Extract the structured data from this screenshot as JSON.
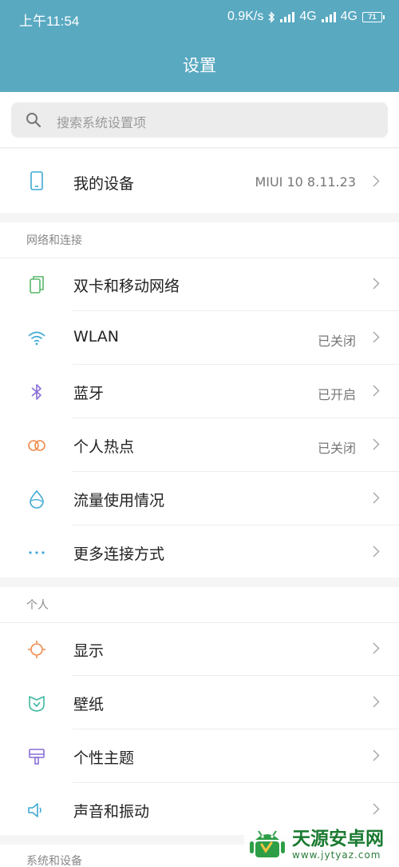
{
  "status_bar": {
    "time": "上午11:54",
    "net_speed": "0.9K/s",
    "network1": "4G",
    "network2": "4G",
    "battery": "71"
  },
  "header": {
    "title": "设置"
  },
  "search": {
    "placeholder": "搜索系统设置项"
  },
  "device": {
    "label": "我的设备",
    "value": "MIUI 10 8.11.23",
    "icon": "phone-icon"
  },
  "network_section": {
    "header": "网络和连接",
    "items": [
      {
        "label": "双卡和移动网络",
        "value": "",
        "icon": "sim-icon",
        "color": "#58b86a"
      },
      {
        "label": "WLAN",
        "value": "已关闭",
        "icon": "wifi-icon",
        "color": "#3fa9d4"
      },
      {
        "label": "蓝牙",
        "value": "已开启",
        "icon": "bluetooth-icon",
        "color": "#8a6fd8"
      },
      {
        "label": "个人热点",
        "value": "已关闭",
        "icon": "hotspot-icon",
        "color": "#f08a4b"
      },
      {
        "label": "流量使用情况",
        "value": "",
        "icon": "data-usage-icon",
        "color": "#3fa9d4"
      },
      {
        "label": "更多连接方式",
        "value": "",
        "icon": "more-icon",
        "color": "#3fa9d4"
      }
    ]
  },
  "personal_section": {
    "header": "个人",
    "items": [
      {
        "label": "显示",
        "value": "",
        "icon": "display-icon",
        "color": "#f08a4b"
      },
      {
        "label": "壁纸",
        "value": "",
        "icon": "wallpaper-icon",
        "color": "#3fb8a0"
      },
      {
        "label": "个性主题",
        "value": "",
        "icon": "theme-icon",
        "color": "#8a6fd8"
      },
      {
        "label": "声音和振动",
        "value": "",
        "icon": "sound-icon",
        "color": "#3fa9d4"
      }
    ]
  },
  "system_section": {
    "header": "系统和设备"
  },
  "watermark": {
    "title": "天源安卓网",
    "url": "www.jytyaz.com"
  }
}
